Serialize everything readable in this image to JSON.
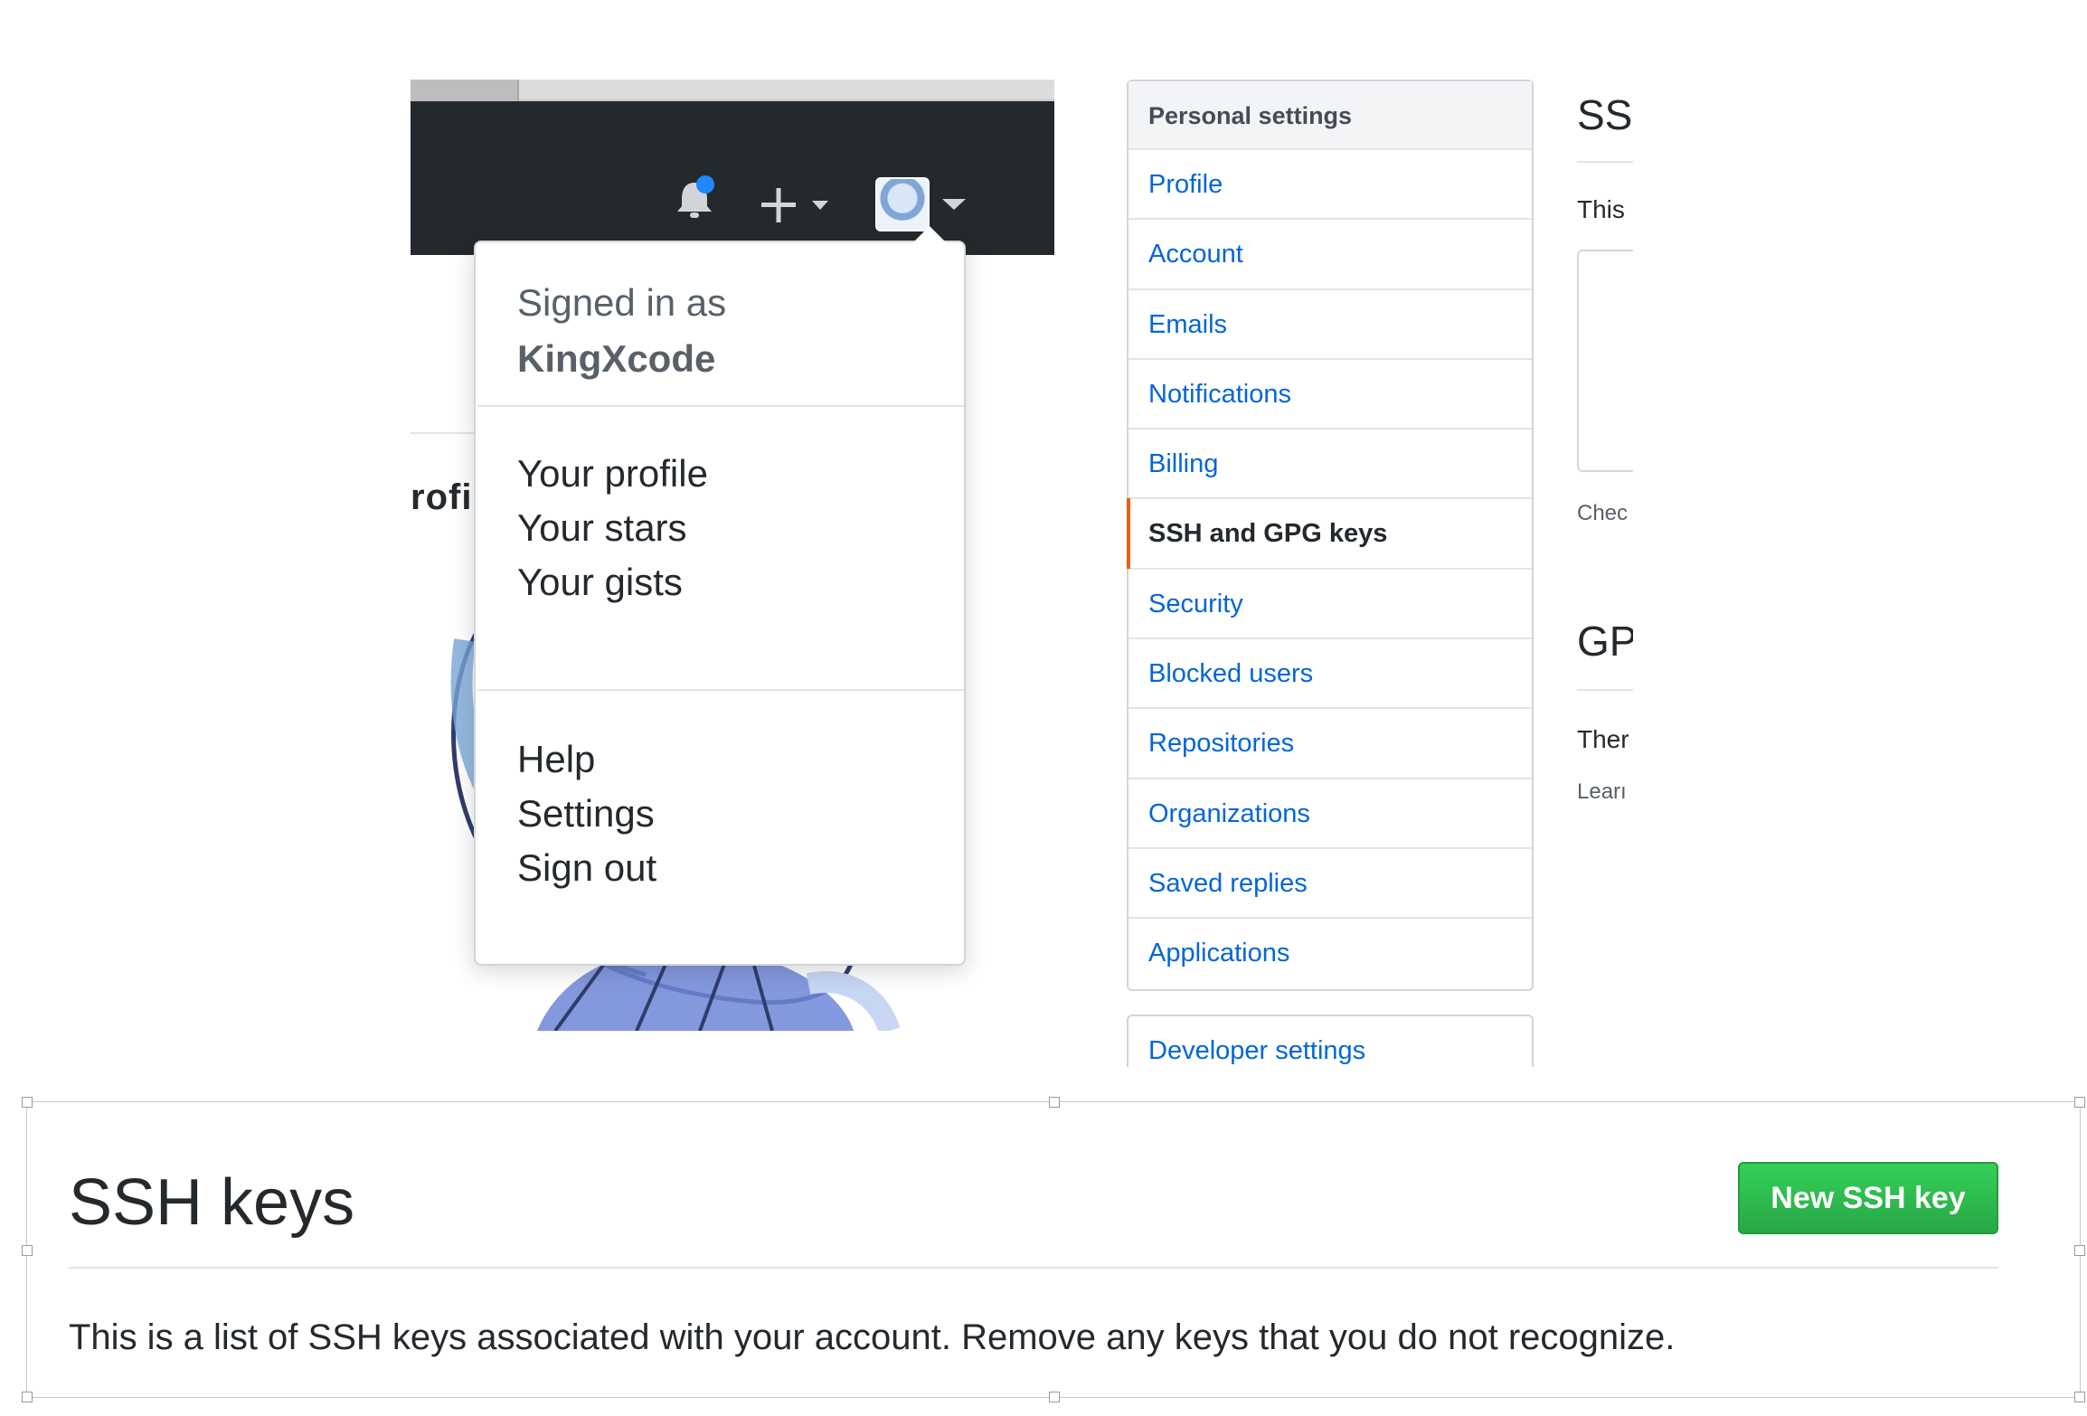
{
  "dropdown": {
    "signed_in_label": "Signed in as",
    "username": "KingXcode",
    "items_group1": [
      "Your profile",
      "Your stars",
      "Your gists"
    ],
    "items_group2": [
      "Help",
      "Settings",
      "Sign out"
    ]
  },
  "page_fragment": {
    "profile_text": "rofil"
  },
  "sidebar": {
    "heading": "Personal settings",
    "items": [
      {
        "label": "Profile",
        "selected": false
      },
      {
        "label": "Account",
        "selected": false
      },
      {
        "label": "Emails",
        "selected": false
      },
      {
        "label": "Notifications",
        "selected": false
      },
      {
        "label": "Billing",
        "selected": false
      },
      {
        "label": "SSH and GPG keys",
        "selected": true
      },
      {
        "label": "Security",
        "selected": false
      },
      {
        "label": "Blocked users",
        "selected": false
      },
      {
        "label": "Repositories",
        "selected": false
      },
      {
        "label": "Organizations",
        "selected": false
      },
      {
        "label": "Saved replies",
        "selected": false
      },
      {
        "label": "Applications",
        "selected": false
      }
    ],
    "developer_settings": "Developer settings"
  },
  "cropped_content": {
    "ssh_heading": "SS",
    "ssh_text": "This",
    "check_text": "Chec",
    "gpg_heading": "GP",
    "gpg_text": "Ther",
    "learn_text": "Learı"
  },
  "ssh_panel": {
    "title": "SSH keys",
    "new_button": "New SSH key",
    "description": "This is a list of SSH keys associated with your account. Remove any keys that you do not recognize."
  },
  "icons": {
    "notifications": "bell-icon",
    "create": "plus-icon",
    "avatar_menu": "chevron-down-icon"
  },
  "colors": {
    "header_bg": "#24292e",
    "link_blue": "#0366d6",
    "selected_accent": "#e36209",
    "button_green": "#28a745",
    "notification_dot": "#2188ff"
  }
}
